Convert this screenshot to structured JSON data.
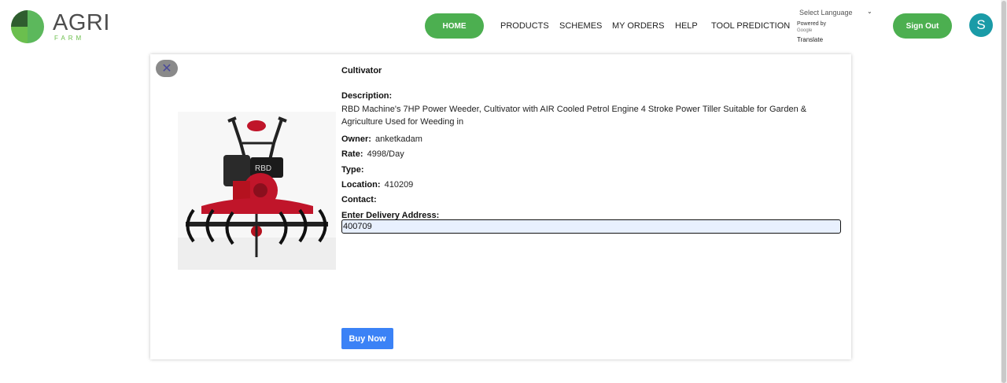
{
  "header": {
    "logo_main": "AGRI",
    "logo_sub": "FARM",
    "nav": {
      "home": "HOME",
      "products": "PRODUCTS",
      "schemes": "SCHEMES",
      "my_orders": "MY ORDERS",
      "help": "HELP",
      "tool_prediction": "TOOL PREDICTION"
    },
    "translate": {
      "select_language": "Select Language",
      "powered_by": "Powered by",
      "google": "Google",
      "translate": "Translate"
    },
    "sign_out": "Sign Out",
    "avatar_initial": "S"
  },
  "product": {
    "title": "Cultivator",
    "description_label": "Description:",
    "description": "RBD Machine's 7HP Power Weeder, Cultivator with AIR Cooled Petrol Engine 4 Stroke Power Tiller Suitable for Garden & Agriculture Used for Weeding in",
    "owner_label": "Owner:",
    "owner": "anketkadam",
    "rate_label": "Rate:",
    "rate": "4998/Day",
    "type_label": "Type:",
    "type": "",
    "location_label": "Location:",
    "location": "410209",
    "contact_label": "Contact:",
    "contact": "",
    "delivery_label": "Enter Delivery Address:",
    "delivery_value": "400709",
    "buy_label": "Buy Now",
    "image_icon": "power-tiller-image",
    "engine_badge": "RBD"
  },
  "colors": {
    "green": "#4caf50",
    "blue": "#3b82f6",
    "avatar": "#1a9ba7"
  }
}
